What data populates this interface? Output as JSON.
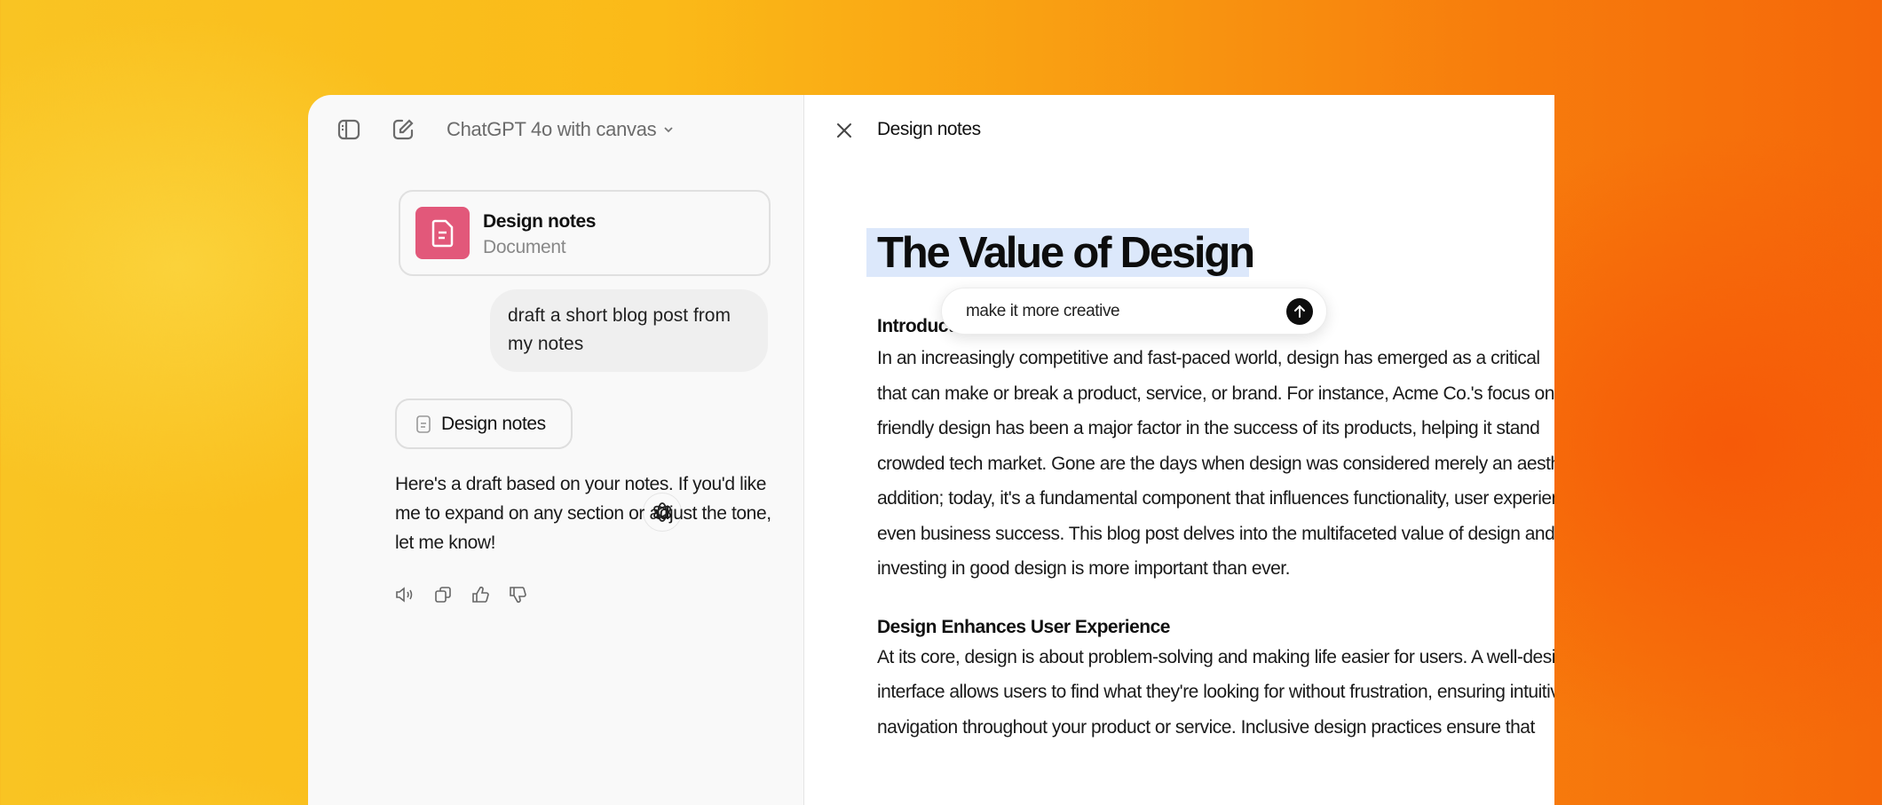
{
  "chat": {
    "model_title": "ChatGPT 4o with canvas",
    "doc_card": {
      "title": "Design notes",
      "subtitle": "Document"
    },
    "user_message": [
      "draft a short blog post from",
      "my notes"
    ],
    "assistant_doc_pill": "Design notes",
    "assistant_reply": [
      "Here's a draft based on your notes. If you'd like",
      "me to expand on any section or adjust the tone,",
      "let me know!"
    ],
    "actions": [
      "speaker-icon",
      "copy-icon",
      "thumbs-up-icon",
      "thumbs-down-icon"
    ]
  },
  "canvas": {
    "title": "Design notes",
    "doc_title": "The Value of Design",
    "prompt": {
      "value": "make it more creative"
    },
    "sections": [
      {
        "heading": "Introduction",
        "lines": [
          "In an increasingly competitive and fast-paced world, design has emerged as a critical",
          "that can make or break a product, service, or brand. For instance, Acme Co.'s focus on",
          "friendly design has been a major factor in the success of its products, helping it stand",
          "crowded tech market. Gone are the days when design was considered merely an aesthetic",
          "addition; today, it's a fundamental component that influences functionality, user experience",
          "even business success. This blog post delves into the multifaceted value of design and",
          "investing in good design is more important than ever."
        ]
      },
      {
        "heading": "Design Enhances User Experience",
        "lines": [
          "At its core, design is about problem-solving and making life easier for users. A well-designed",
          "interface allows users to find what they're looking for without frustration, ensuring intuitive",
          "navigation throughout your product or service. Inclusive design practices ensure that"
        ]
      }
    ]
  },
  "colors": {
    "doc_icon": "#e2587a",
    "highlight": "#dce8fb",
    "send_button": "#0d0d0d"
  }
}
